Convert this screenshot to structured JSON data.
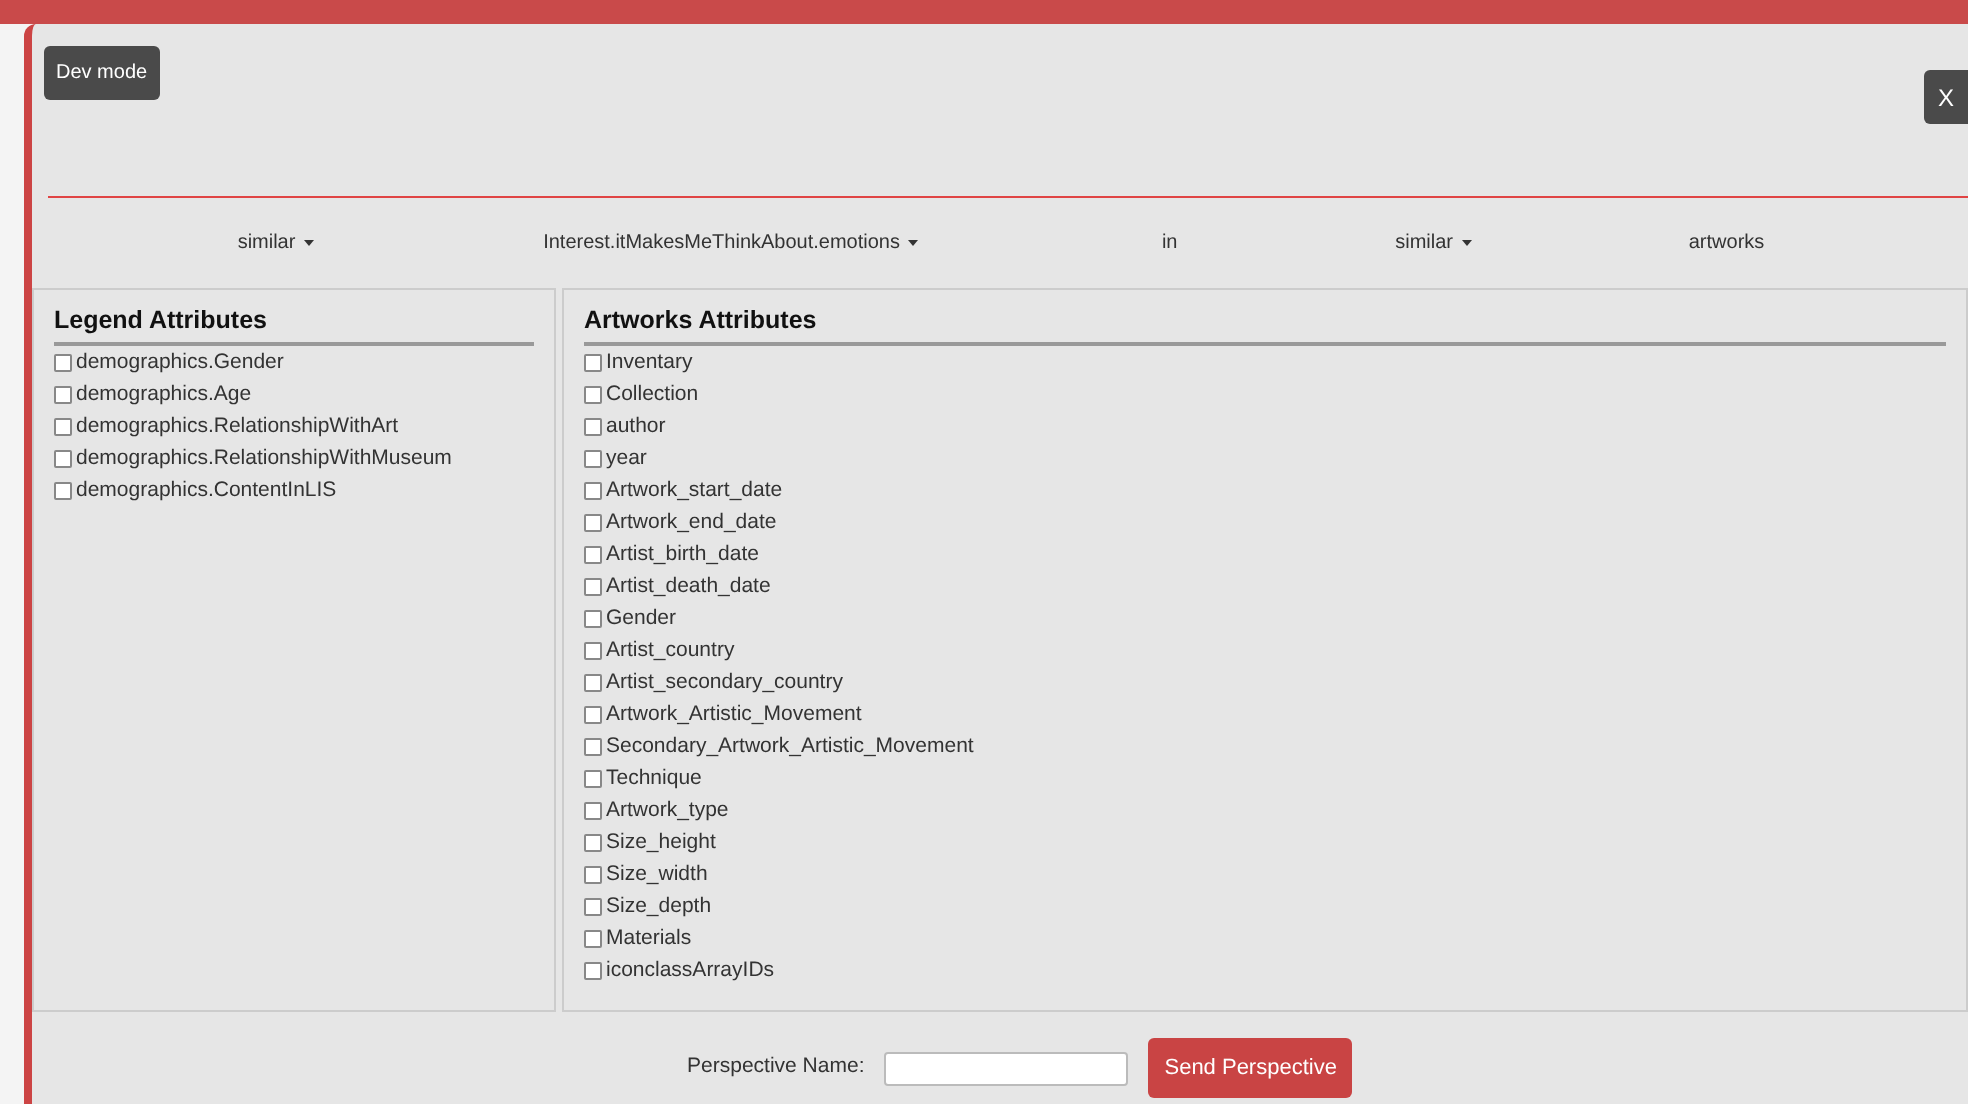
{
  "toolbar": {
    "dev_mode_button": "Dev mode",
    "close_button": "X"
  },
  "query": [
    {
      "kind": "dropdown",
      "label": "similar"
    },
    {
      "kind": "dropdown",
      "label": "Interest.itMakesMeThinkAbout.emotions"
    },
    {
      "kind": "text",
      "label": "in"
    },
    {
      "kind": "dropdown",
      "label": "similar"
    },
    {
      "kind": "text",
      "label": "artworks"
    }
  ],
  "legend_panel": {
    "title": "Legend Attributes",
    "items": [
      {
        "label": "demographics.Gender",
        "checked": false
      },
      {
        "label": "demographics.Age",
        "checked": false
      },
      {
        "label": "demographics.RelationshipWithArt",
        "checked": false
      },
      {
        "label": "demographics.RelationshipWithMuseum",
        "checked": false
      },
      {
        "label": "demographics.ContentInLIS",
        "checked": false
      }
    ]
  },
  "artworks_panel": {
    "title": "Artworks Attributes",
    "items": [
      {
        "label": "Inventary",
        "checked": false
      },
      {
        "label": "Collection",
        "checked": false
      },
      {
        "label": "author",
        "checked": false
      },
      {
        "label": "year",
        "checked": false
      },
      {
        "label": "Artwork_start_date",
        "checked": false
      },
      {
        "label": "Artwork_end_date",
        "checked": false
      },
      {
        "label": "Artist_birth_date",
        "checked": false
      },
      {
        "label": "Artist_death_date",
        "checked": false
      },
      {
        "label": "Gender",
        "checked": false
      },
      {
        "label": "Artist_country",
        "checked": false
      },
      {
        "label": "Artist_secondary_country",
        "checked": false
      },
      {
        "label": "Artwork_Artistic_Movement",
        "checked": false
      },
      {
        "label": "Secondary_Artwork_Artistic_Movement",
        "checked": false
      },
      {
        "label": "Technique",
        "checked": false
      },
      {
        "label": "Artwork_type",
        "checked": false
      },
      {
        "label": "Size_height",
        "checked": false
      },
      {
        "label": "Size_width",
        "checked": false
      },
      {
        "label": "Size_depth",
        "checked": false
      },
      {
        "label": "Materials",
        "checked": false
      },
      {
        "label": "iconclassArrayIDs",
        "checked": false
      }
    ]
  },
  "footer": {
    "label": "Perspective Name:",
    "send_button": "Send Perspective"
  }
}
